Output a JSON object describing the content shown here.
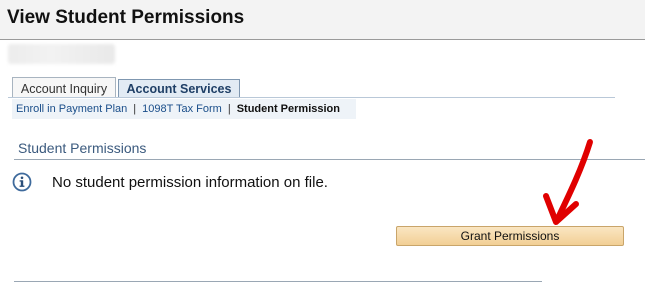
{
  "page": {
    "title": "View Student Permissions"
  },
  "tabs": [
    {
      "label": "Account Inquiry",
      "active": false
    },
    {
      "label": "Account Services",
      "active": true
    }
  ],
  "subnav": {
    "items": [
      {
        "label": "Enroll in Payment Plan",
        "link": true
      },
      {
        "label": "1098T Tax Form",
        "link": true
      },
      {
        "label": "Student Permission",
        "link": false,
        "current": true
      }
    ],
    "separator": "|"
  },
  "section": {
    "title": "Student Permissions",
    "message": "No student permission information on file.",
    "icon": "info-icon"
  },
  "actions": {
    "grant_label": "Grant Permissions"
  },
  "colors": {
    "tab_active_bg": "#e2ebf4",
    "button_bg": "#f2cf95",
    "annotation_arrow": "#e00000",
    "link": "#1a4e8a",
    "section_title": "#3b5a7e"
  }
}
